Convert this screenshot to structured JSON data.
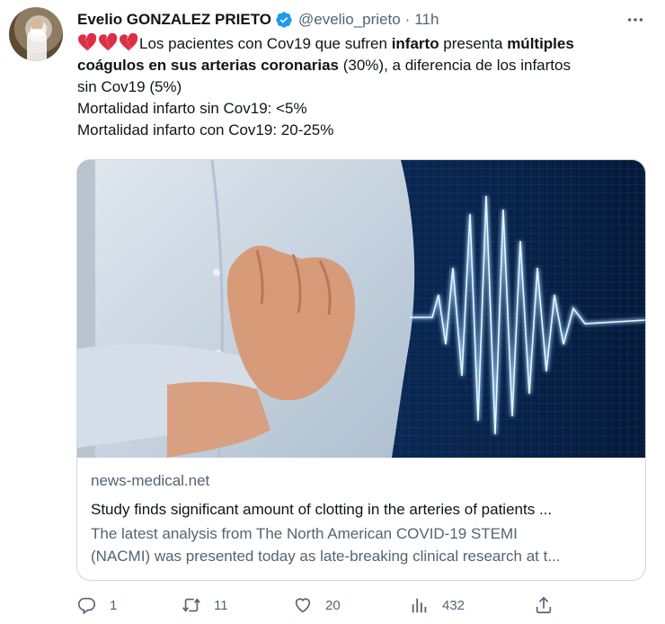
{
  "tweet": {
    "author_name": "Evelio GONZALEZ PRIETO",
    "handle": "@evelio_prieto",
    "separator": "·",
    "time": "11h",
    "verified_icon": "verified-badge-icon",
    "more_icon": "more-options-icon",
    "emoji": [
      "broken-heart",
      "broken-heart",
      "broken-heart"
    ],
    "text": {
      "l1_a": "Los pacientes con Cov19 que sufren ",
      "l1_b": "infarto",
      "l1_c": " presenta ",
      "l1_d": "múltiples",
      "l2_a": "coágulos en sus arterias coronarias",
      "l2_b": " (30%), a diferencia de los infartos",
      "l3": "sin Cov19 (5%)",
      "l4": "Mortalidad infarto sin Cov19: <5%",
      "l5": "Mortalidad infarto con Cov19: 20-25%"
    }
  },
  "card": {
    "image": "man-clutching-chest-with-heartbeat-ecg-line",
    "domain": "news-medical.net",
    "title": "Study finds significant amount of clotting in the arteries of patients ...",
    "description_line1": "The latest analysis from The North American COVID-19 STEMI",
    "description_line2": "(NACMI) was presented today as late-breaking clinical research at t..."
  },
  "actions": {
    "reply_count": "1",
    "retweet_count": "11",
    "like_count": "20",
    "views_count": "432"
  },
  "colors": {
    "text_primary": "#0f1419",
    "text_secondary": "#536471",
    "verified_blue": "#1d9bf0",
    "card_border": "#cfd9de",
    "emoji_red": "#dd2e44"
  }
}
